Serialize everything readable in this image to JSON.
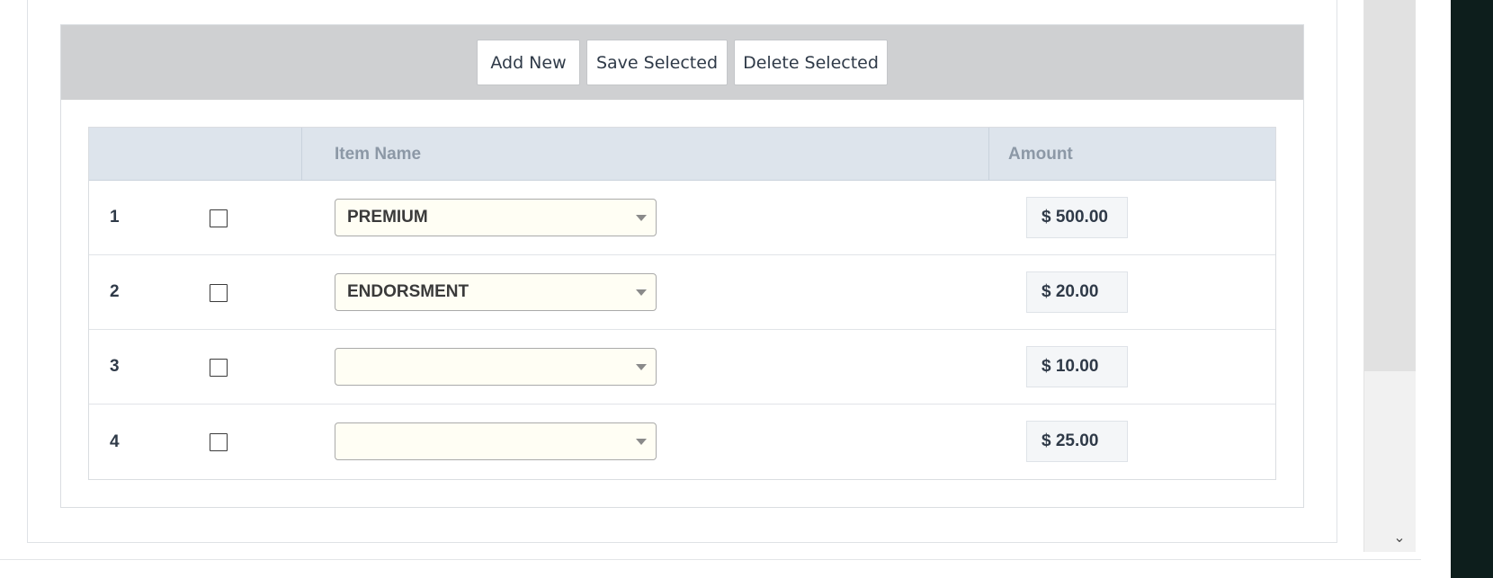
{
  "toolbar": {
    "add_label": "Add New",
    "save_label": "Save Selected",
    "delete_label": "Delete Selected"
  },
  "grid": {
    "columns": [
      "",
      "Item Name",
      "Amount"
    ],
    "rows": [
      {
        "num": "1",
        "checked": false,
        "item": "PREMIUM",
        "amount": "$ 500.00"
      },
      {
        "num": "2",
        "checked": false,
        "item": "ENDORSMENT",
        "amount": "$ 20.00"
      },
      {
        "num": "3",
        "checked": false,
        "item": "",
        "amount": "$ 10.00"
      },
      {
        "num": "4",
        "checked": false,
        "item": "",
        "amount": "$ 25.00"
      }
    ]
  },
  "scrollbar": {
    "down_icon": "chevron-down-icon"
  },
  "colors": {
    "toolbar_bg": "#cfd0d2",
    "header_bg": "#dde4ec",
    "select_bg": "#fffef4",
    "right_edge": "#0d1e1c"
  }
}
